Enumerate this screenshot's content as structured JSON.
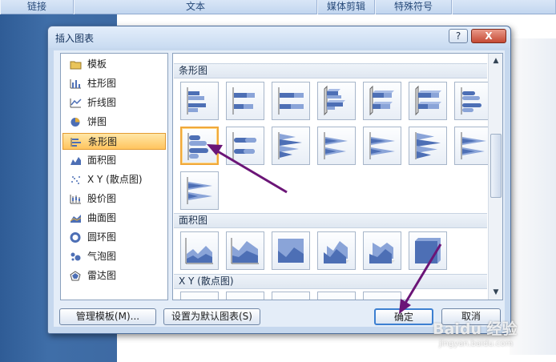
{
  "ribbon": {
    "groups": [
      "链接",
      "",
      "文本",
      "媒体剪辑",
      "特殊符号",
      ""
    ]
  },
  "dialog": {
    "title": "插入图表",
    "help_label": "?",
    "close_label": "X"
  },
  "chart_types": [
    {
      "label": "模板",
      "icon": "folder-icon",
      "selected": false
    },
    {
      "label": "柱形图",
      "icon": "column-chart-icon",
      "selected": false
    },
    {
      "label": "折线图",
      "icon": "line-chart-icon",
      "selected": false
    },
    {
      "label": "饼图",
      "icon": "pie-chart-icon",
      "selected": false
    },
    {
      "label": "条形图",
      "icon": "bar-chart-icon",
      "selected": true
    },
    {
      "label": "面积图",
      "icon": "area-chart-icon",
      "selected": false
    },
    {
      "label": "X Y (散点图)",
      "icon": "scatter-chart-icon",
      "selected": false
    },
    {
      "label": "股价图",
      "icon": "stock-chart-icon",
      "selected": false
    },
    {
      "label": "曲面图",
      "icon": "surface-chart-icon",
      "selected": false
    },
    {
      "label": "圆环图",
      "icon": "doughnut-chart-icon",
      "selected": false
    },
    {
      "label": "气泡图",
      "icon": "bubble-chart-icon",
      "selected": false
    },
    {
      "label": "雷达图",
      "icon": "radar-chart-icon",
      "selected": false
    }
  ],
  "gallery": {
    "sections": [
      "条形图",
      "面积图",
      "X Y (散点图)"
    ],
    "selected_subtype": "bar-3d-cylinder-clustered"
  },
  "buttons": {
    "manage_templates": "管理模板(M)...",
    "set_default": "设置为默认图表(S)",
    "ok": "确定",
    "cancel": "取消"
  },
  "watermark": {
    "brand": "Baidu 经验",
    "url": "jingyan.baidu.com"
  },
  "colors": {
    "accent": "#f0a83a",
    "annotation_arrow": "#6b1577",
    "chart_fill": "#4d6fb5"
  }
}
